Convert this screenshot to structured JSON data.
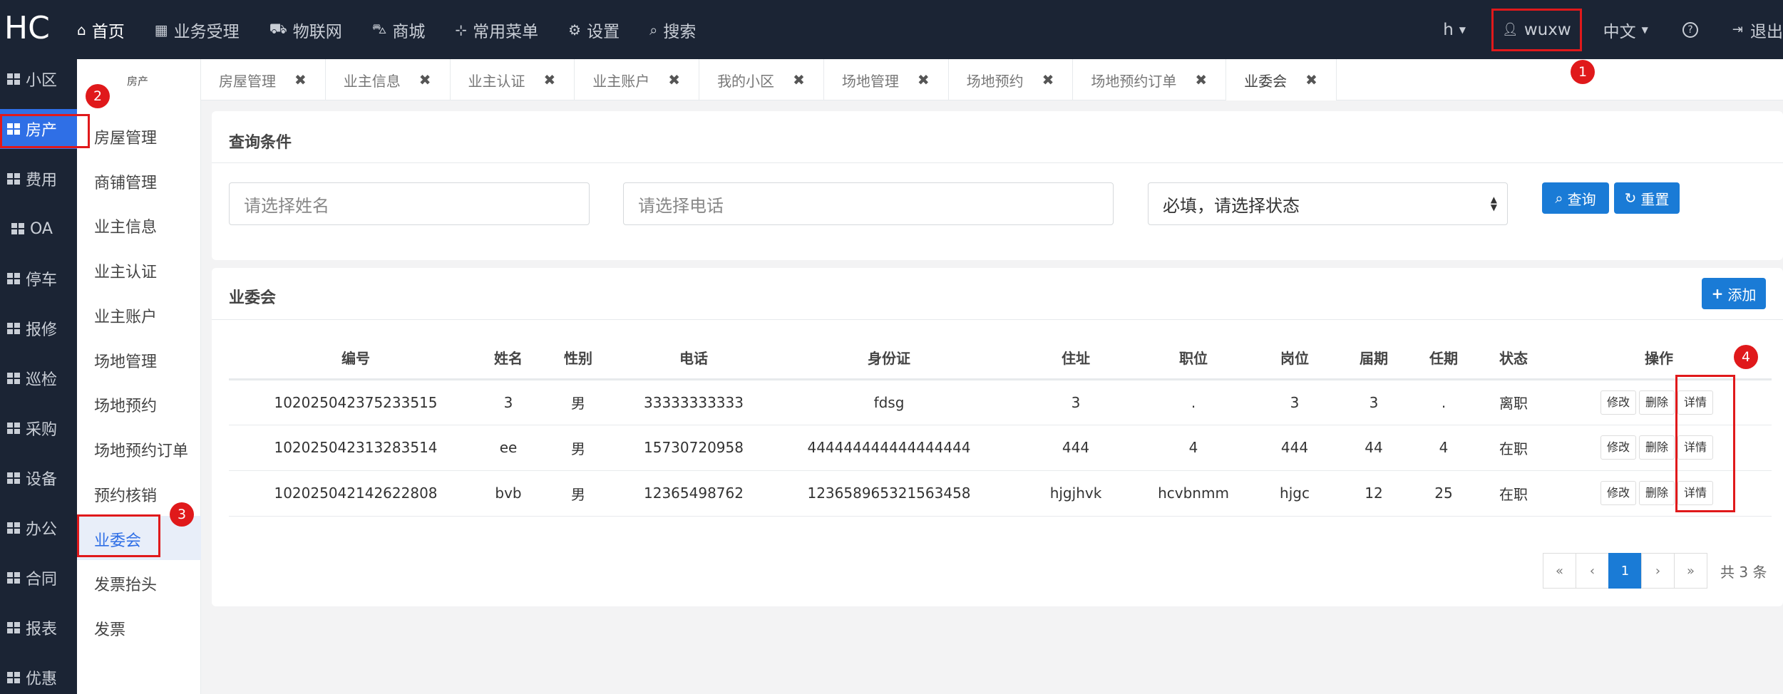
{
  "app": {
    "logo": "HC"
  },
  "topnav": [
    {
      "icon": "home-icon",
      "glyph": "⌂",
      "label": "首页"
    },
    {
      "icon": "calculator-icon",
      "glyph": "▦",
      "label": "业务受理"
    },
    {
      "icon": "car-icon",
      "glyph": "⛟",
      "label": "物联网"
    },
    {
      "icon": "cart-icon",
      "glyph": "⛍",
      "label": "商城"
    },
    {
      "icon": "sitemap-icon",
      "glyph": "⊹",
      "label": "常用菜单"
    },
    {
      "icon": "gear-icon",
      "glyph": "⚙",
      "label": "设置"
    },
    {
      "icon": "search-icon",
      "glyph": "⌕",
      "label": "搜索"
    }
  ],
  "topright": {
    "h": "h",
    "user": "wuxw",
    "lang": "中文",
    "help": "?",
    "logout": "退出"
  },
  "iconbar": [
    "小区",
    "房产",
    "费用",
    "OA",
    "停车",
    "报修",
    "巡检",
    "采购",
    "设备",
    "办公",
    "合同",
    "报表",
    "优惠"
  ],
  "submenu": {
    "head": "房产",
    "items": [
      "房屋管理",
      "商铺管理",
      "业主信息",
      "业主认证",
      "业主账户",
      "场地管理",
      "场地预约",
      "场地预约订单",
      "预约核销",
      "业委会",
      "发票抬头",
      "发票"
    ]
  },
  "tabs": [
    "房屋管理",
    "业主信息",
    "业主认证",
    "业主账户",
    "我的小区",
    "场地管理",
    "场地预约",
    "场地预约订单",
    "业委会"
  ],
  "query": {
    "title": "查询条件",
    "name_placeholder": "请选择姓名",
    "phone_placeholder": "请选择电话",
    "status_value": "必填，请选择状态",
    "search_label": "查询",
    "reset_label": "重置"
  },
  "committee": {
    "title": "业委会",
    "add_label": "添加",
    "columns": [
      "编号",
      "姓名",
      "性别",
      "电话",
      "身份证",
      "住址",
      "职位",
      "岗位",
      "届期",
      "任期",
      "状态",
      "操作"
    ],
    "rows": [
      [
        "102025042375233515",
        "3",
        "男",
        "33333333333",
        "fdsg",
        "3",
        ".",
        "3",
        "3",
        ".",
        "离职"
      ],
      [
        "102025042313283514",
        "ee",
        "男",
        "15730720958",
        "444444444444444444",
        "444",
        "4",
        "444",
        "44",
        "4",
        "在职"
      ],
      [
        "102025042142622808",
        "bvb",
        "男",
        "12365498762",
        "123658965321563458",
        "hjgjhvk",
        "hcvbnmm",
        "hjgc",
        "12",
        "25",
        "在职"
      ]
    ],
    "actions": {
      "edit": "修改",
      "delete": "删除",
      "detail": "详情"
    },
    "pager": {
      "first": "«",
      "prev": "‹",
      "page": "1",
      "next": "›",
      "last": "»",
      "total": "共 3 条"
    }
  },
  "markers": [
    "1",
    "2",
    "3",
    "4"
  ],
  "colors": {
    "topbar": "#1b2434",
    "accent": "#2f6fe6",
    "button": "#1a7bd6",
    "highlight": "#e0191b"
  }
}
